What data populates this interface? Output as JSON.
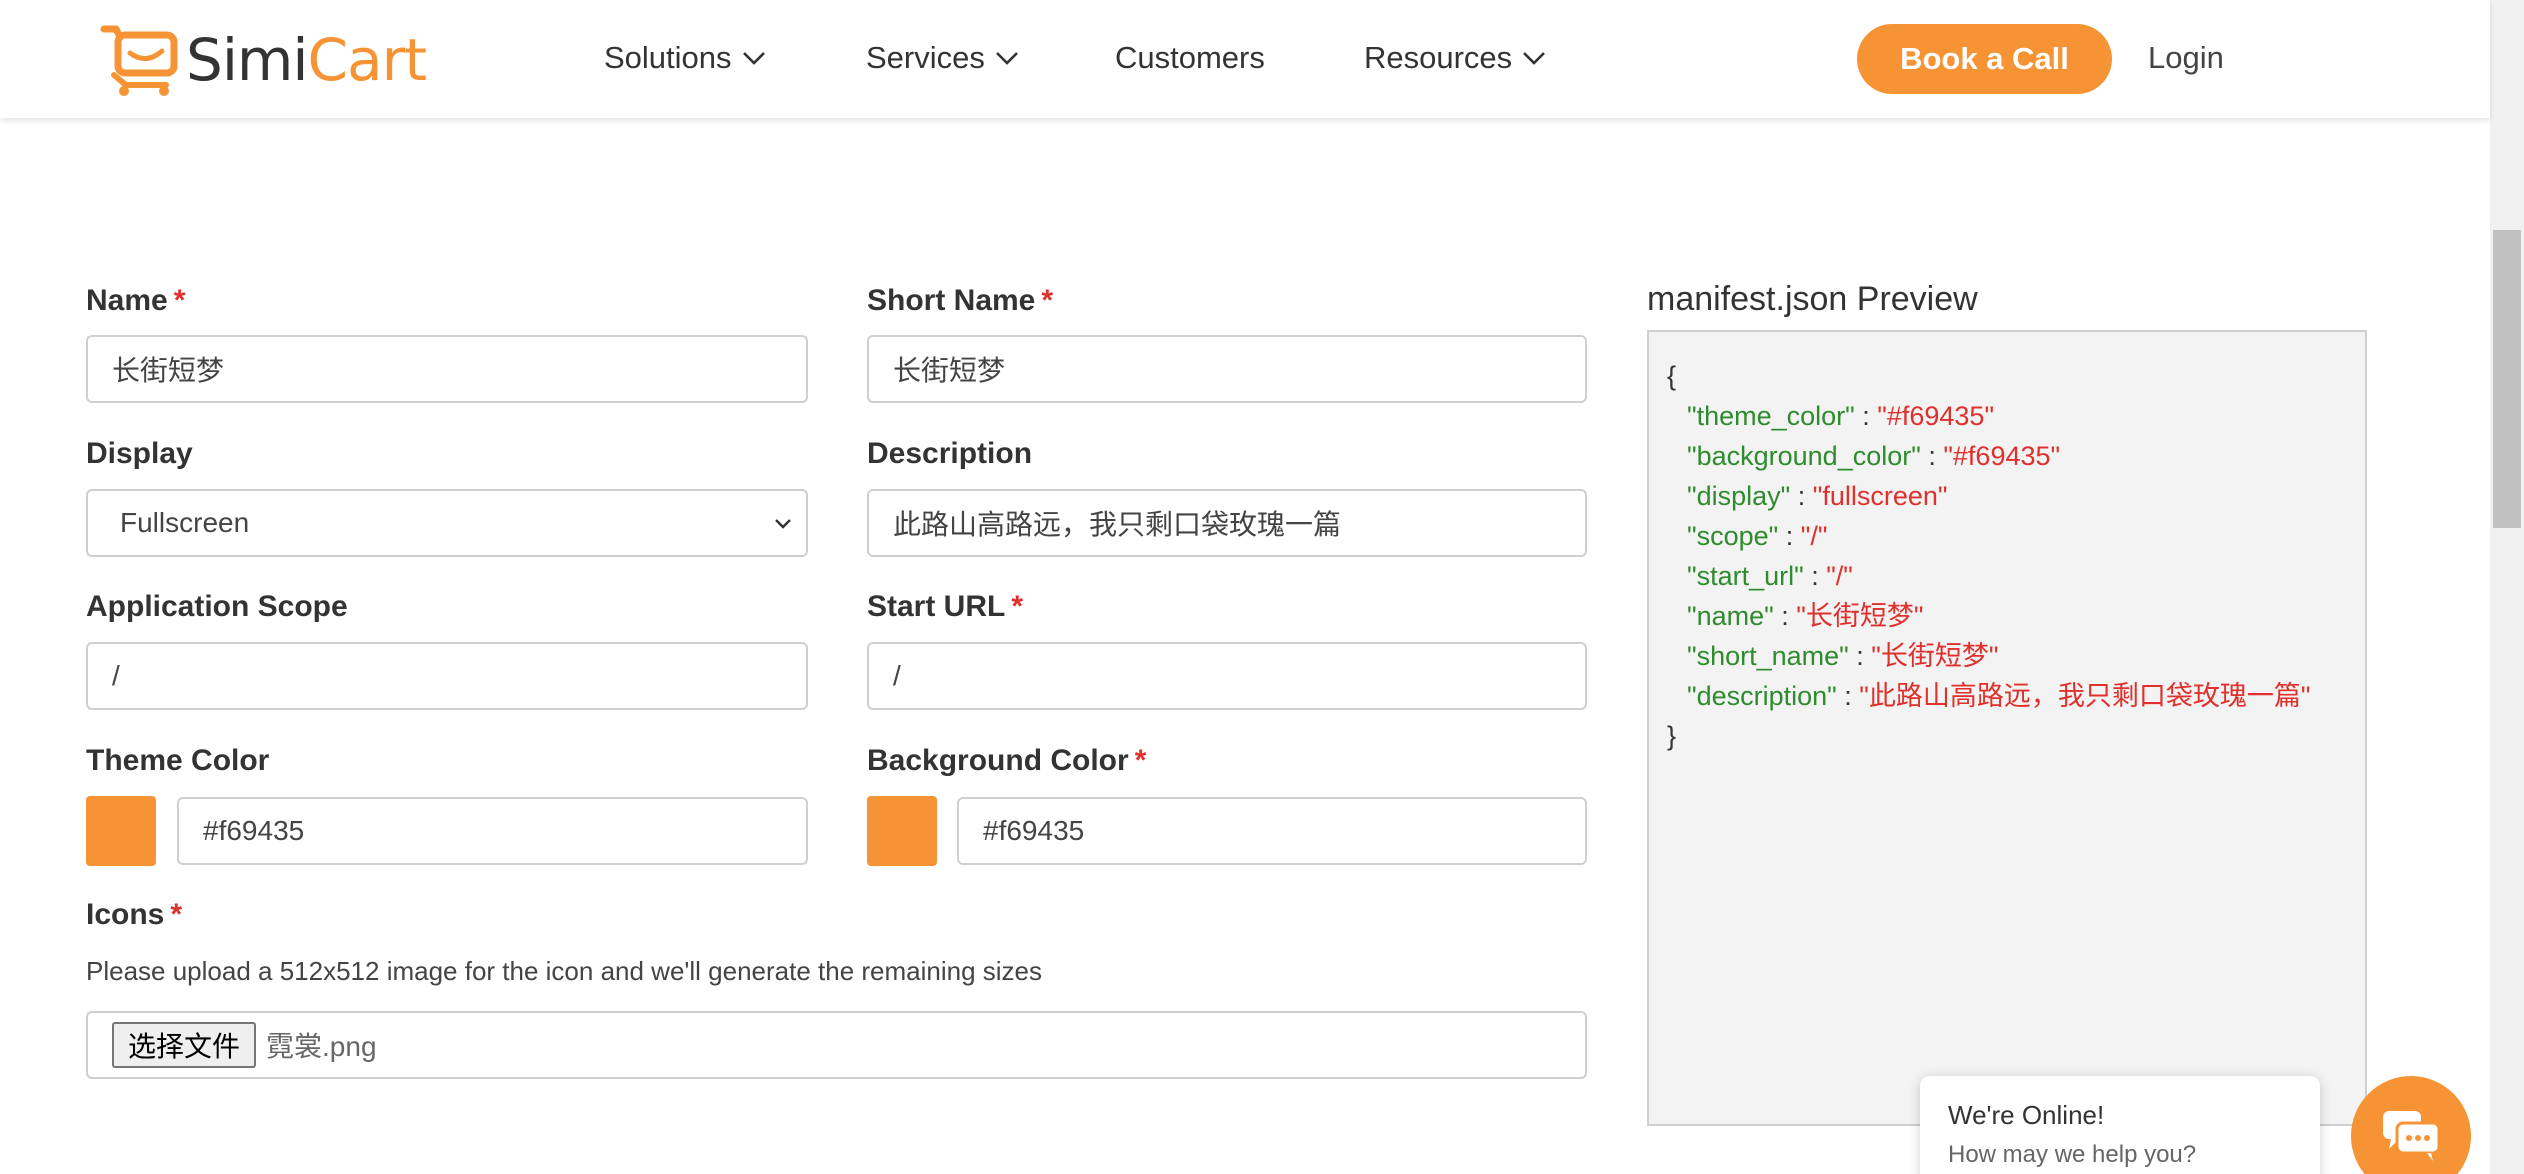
{
  "header": {
    "logo": {
      "simi": "Simi",
      "cart": "Cart"
    },
    "nav": [
      {
        "label": "Solutions"
      },
      {
        "label": "Services"
      },
      {
        "label": "Customers"
      },
      {
        "label": "Resources"
      }
    ],
    "cta_label": "Book a Call",
    "login_label": "Login"
  },
  "form": {
    "name": {
      "label": "Name",
      "required_mark": "*",
      "value": "长街短梦"
    },
    "short_name": {
      "label": "Short Name",
      "required_mark": "*",
      "value": "长街短梦"
    },
    "display": {
      "label": "Display",
      "value": "Fullscreen"
    },
    "description": {
      "label": "Description",
      "value": "此路山高路远，我只剩口袋玫瑰一篇"
    },
    "scope": {
      "label": "Application Scope",
      "value": "/"
    },
    "start_url": {
      "label": "Start URL",
      "required_mark": "*",
      "value": "/"
    },
    "theme_color": {
      "label": "Theme Color",
      "value": "#f69435"
    },
    "background_color": {
      "label": "Background Color",
      "required_mark": "*",
      "value": "#f69435"
    },
    "icons": {
      "label": "Icons",
      "required_mark": "*",
      "hint": "Please upload a 512x512 image for the icon and we'll generate the remaining sizes",
      "button_label": "选择文件",
      "file_name": "霓裳.png"
    }
  },
  "preview": {
    "title": "manifest.json Preview",
    "open_brace": "{",
    "close_brace": "}",
    "lines": [
      {
        "key": "\"theme_color\"",
        "value": "\"#f69435\""
      },
      {
        "key": "\"background_color\"",
        "value": "\"#f69435\""
      },
      {
        "key": "\"display\"",
        "value": "\"fullscreen\""
      },
      {
        "key": "\"scope\"",
        "value": "\"/\""
      },
      {
        "key": "\"start_url\"",
        "value": "\"/\""
      },
      {
        "key": "\"name\"",
        "value": "\"长街短梦\""
      },
      {
        "key": "\"short_name\"",
        "value": "\"长街短梦\""
      },
      {
        "key": "\"description\"",
        "value": "\"此路山高路远，我只剩口袋玫瑰一篇\""
      }
    ],
    "separator": " : "
  },
  "chat": {
    "status": "We're Online!",
    "prompt": "How may we help you?"
  },
  "colors": {
    "brand_orange": "#f69435",
    "key_green": "#2e8b2e",
    "value_red": "#e0302c"
  },
  "icons": {
    "logo": "cart-monitor-icon",
    "chevron": "chevron-down-icon",
    "select_arrow": "select-arrow-icon",
    "chat": "chat-bubble-icon"
  }
}
